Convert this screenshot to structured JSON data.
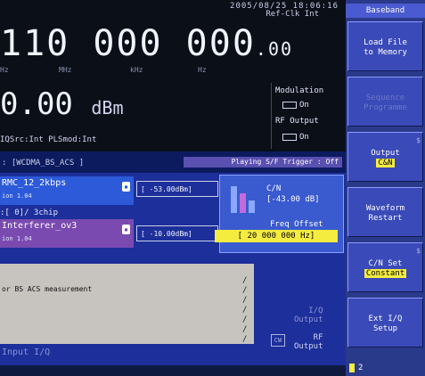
{
  "header": {
    "date": "2005/08/25  18:06:16",
    "ref_clock": "Ref-Clk Int"
  },
  "frequency": {
    "main": "110 000 000",
    "decimal": ".00",
    "units": [
      "Hz",
      "MHz",
      "kHz",
      "Hz"
    ]
  },
  "level": {
    "value": "0.00",
    "unit": "dBm"
  },
  "status_line": "IQSrc:Int   PLSmod:Int",
  "mod_panel": {
    "modulation_label": "Modulation",
    "modulation_state": "On",
    "rf_output_label": "RF Output",
    "rf_output_state": "On"
  },
  "channel_bar": {
    "title": ": [WCDMA_BS_ACS          ]",
    "playing": "Playing  S/F Trigger : Off"
  },
  "signals": {
    "sig1_label": "RMC_12_2kbps",
    "sig1_version": "ion 1.04",
    "sig1_level": "[ -53.00dBm]",
    "mid_row": ":[      0]/  3chip",
    "sig2_label": "Interferer_ov3",
    "sig2_version": "ion 1.04",
    "sig2_level": "[ -10.00dBm]"
  },
  "cn_panel": {
    "cn_label": "C/N",
    "cn_value": "[-43.00 dB]",
    "freq_offset_label": "Freq Offset",
    "freq_offset_value": "[ 20 000 000 Hz]"
  },
  "message": {
    "text": "or BS ACS measurement"
  },
  "outputs": {
    "iq_output": "I/Q\nOutput",
    "cw": "CW",
    "rf_output": "RF\nOutput",
    "input_iq": "Input I/Q"
  },
  "sidebar": {
    "title": "Baseband",
    "buttons": [
      {
        "label": "Load File\nto Memory",
        "enabled": true
      },
      {
        "label": "Sequence\nProgramme",
        "enabled": false
      },
      {
        "label": "Output",
        "value": "C&N",
        "enabled": true
      },
      {
        "label": "Waveform\nRestart",
        "enabled": true
      },
      {
        "label": "C/N Set",
        "value": "Constant",
        "enabled": true
      },
      {
        "label": "Ext I/Q\nSetup",
        "enabled": true
      }
    ],
    "page": "2"
  },
  "colors": {
    "highlight": "#f5ec40",
    "panel_blue": "#1d2f9a",
    "softkey": "#3a4ab8"
  }
}
